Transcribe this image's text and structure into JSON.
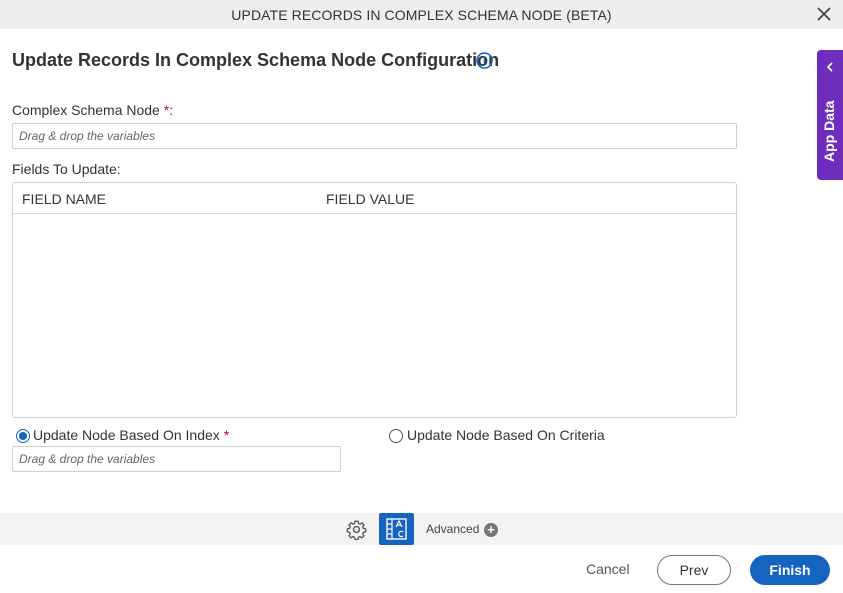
{
  "dialog": {
    "title": "UPDATE RECORDS IN COMPLEX SCHEMA NODE (BETA)",
    "heading": "Update Records In Complex Schema Node Configuration"
  },
  "form": {
    "complex_schema_node_label": "Complex Schema Node",
    "required_mark": "*",
    "colon": ":",
    "complex_schema_node_placeholder": "Drag & drop the variables",
    "fields_to_update_label": "Fields To Update:",
    "grid": {
      "columns": [
        "FIELD NAME",
        "FIELD VALUE"
      ]
    },
    "radio_index_label": "Update Node Based On Index",
    "radio_criteria_label": "Update Node Based On Criteria",
    "index_placeholder": "Drag & drop the variables"
  },
  "toolbar": {
    "advanced_label": "Advanced"
  },
  "footer": {
    "cancel_label": "Cancel",
    "prev_label": "Prev",
    "finish_label": "Finish"
  },
  "side_panel": {
    "label": "App Data"
  },
  "colors": {
    "primary": "#1565c0",
    "side_panel": "#6f2dbd",
    "required": "#d0021b"
  }
}
